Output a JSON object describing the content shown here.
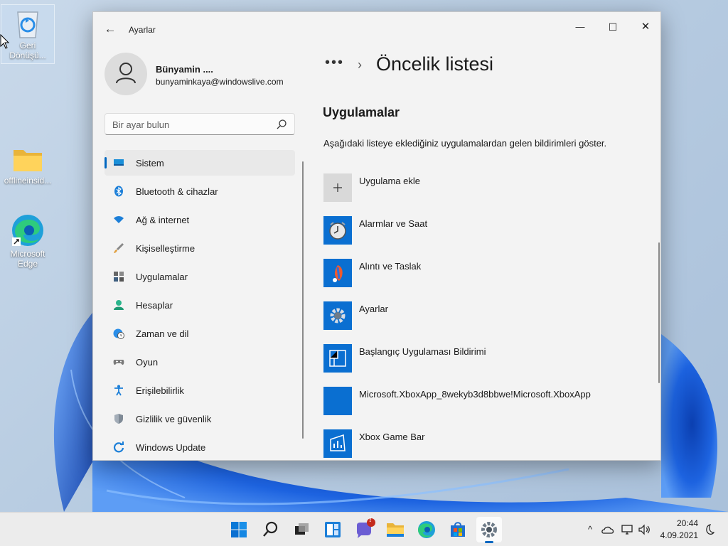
{
  "desktop": {
    "icons": [
      {
        "name": "recycle-bin",
        "label": "Geri Dönüşü..."
      },
      {
        "name": "folder",
        "label": "offlineinsid..."
      },
      {
        "name": "edge",
        "label": "Microsoft Edge"
      }
    ]
  },
  "window": {
    "title": "Ayarlar",
    "caption": {
      "minimize": "—",
      "maximize": "☐",
      "close": "✕"
    },
    "user": {
      "name": "Bünyamin ....",
      "email": "bunyaminkaya@windowslive.com"
    },
    "search": {
      "placeholder": "Bir ayar bulun"
    },
    "nav": [
      {
        "label": "Sistem",
        "icon": "monitor-icon",
        "active": true
      },
      {
        "label": "Bluetooth & cihazlar",
        "icon": "bluetooth-icon"
      },
      {
        "label": "Ağ & internet",
        "icon": "wifi-icon"
      },
      {
        "label": "Kişiselleştirme",
        "icon": "brush-icon"
      },
      {
        "label": "Uygulamalar",
        "icon": "apps-icon"
      },
      {
        "label": "Hesaplar",
        "icon": "person-icon"
      },
      {
        "label": "Zaman ve dil",
        "icon": "globe-clock-icon"
      },
      {
        "label": "Oyun",
        "icon": "gamepad-icon"
      },
      {
        "label": "Erişilebilirlik",
        "icon": "accessibility-icon"
      },
      {
        "label": "Gizlilik ve güvenlik",
        "icon": "shield-icon"
      },
      {
        "label": "Windows Update",
        "icon": "update-icon"
      }
    ],
    "breadcrumb": {
      "ellipsis": "•••",
      "chevron": "›"
    },
    "page_title": "Öncelik listesi",
    "section_title": "Uygulamalar",
    "description": "Aşağıdaki listeye eklediğiniz uygulamalardan gelen bildirimleri göster.",
    "apps": [
      {
        "label": "Uygulama ekle",
        "icon": "add-icon"
      },
      {
        "label": "Alarmlar ve Saat",
        "icon": "alarm-clock-icon"
      },
      {
        "label": "Alıntı ve Taslak",
        "icon": "snip-sketch-icon"
      },
      {
        "label": "Ayarlar",
        "icon": "settings-gear-icon"
      },
      {
        "label": "Başlangıç Uygulaması Bildirimi",
        "icon": "startup-app-icon"
      },
      {
        "label": "Microsoft.XboxApp_8wekyb3d8bbwe!Microsoft.XboxApp",
        "icon": "blank-app-icon"
      },
      {
        "label": "Xbox Game Bar",
        "icon": "game-bar-icon"
      }
    ]
  },
  "taskbar": {
    "apps": [
      "start-icon",
      "search-icon",
      "task-view-icon",
      "widgets-icon",
      "chat-icon",
      "file-explorer-icon",
      "edge-icon",
      "store-icon",
      "settings-icon"
    ],
    "chat_badge": "!",
    "tray": {
      "chevron": "^"
    },
    "clock": {
      "time": "20:44",
      "date": "4.09.2021"
    }
  },
  "colors": {
    "accent": "#0067c0",
    "tile": "#0a6fd1"
  }
}
